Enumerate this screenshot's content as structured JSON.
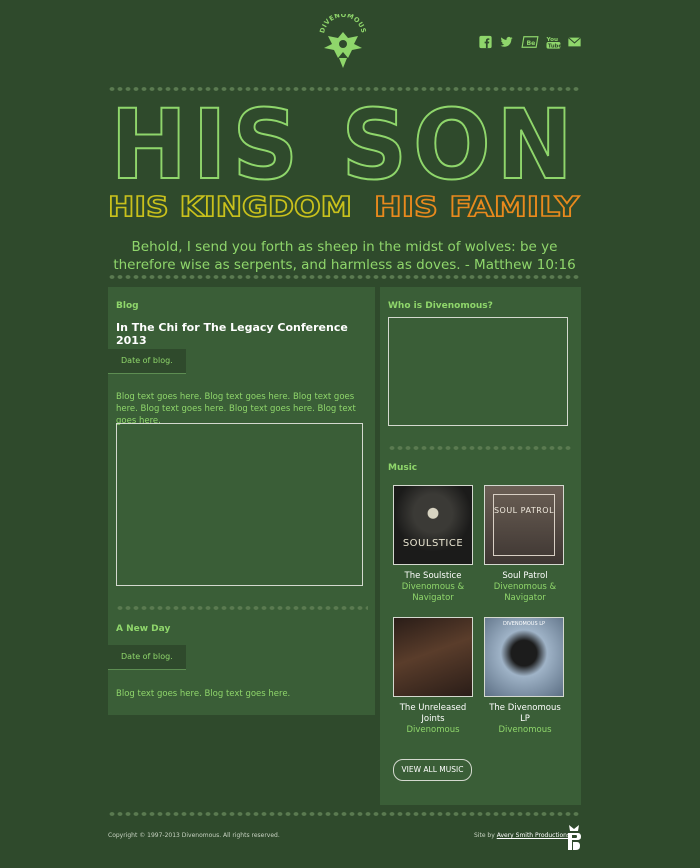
{
  "header": {
    "logo_text": "DIVENOMOUS",
    "social": [
      "facebook-icon",
      "twitter-icon",
      "behance-icon",
      "youtube-icon",
      "email-icon"
    ],
    "hero_title": "HIS SON",
    "subtitle_1": "HIS KINGDOM",
    "subtitle_2": "HIS FAMILY",
    "verse": "Behold, I send you forth as sheep in the midst of wolves: be ye therefore wise as serpents, and harmless as doves. - Matthew 10:16"
  },
  "colors": {
    "background": "#2f4a2c",
    "panel": "#3a5e37",
    "accent_green": "#8fd66b",
    "accent_yellow": "#c9c11c",
    "accent_orange": "#e98a1d"
  },
  "blog": {
    "section_label": "Blog",
    "posts": [
      {
        "title": "In The Chi for The Legacy Conference 2013",
        "date": "Date of blog.",
        "text": "Blog text goes here. Blog text goes here. Blog text goes here. Blog text goes here. Blog text goes here. Blog text goes here."
      },
      {
        "title": "A New Day",
        "date": "Date of blog.",
        "text": "Blog text goes here. Blog text goes here."
      }
    ]
  },
  "about": {
    "section_label": "Who is Divenomous?"
  },
  "music": {
    "section_label": "Music",
    "albums": [
      {
        "title": "The Soulstice",
        "artist": "Divenomous & Navigator",
        "cover_text": "SOULSTICE"
      },
      {
        "title": "Soul Patrol",
        "artist": "Divenomous & Navigator",
        "cover_text": "SOUL PATROL"
      },
      {
        "title": "The Unreleased Joints",
        "artist": "Divenomous",
        "cover_text": ""
      },
      {
        "title": "The Divenomous LP",
        "artist": "Divenomous",
        "cover_text": "DIVENOMOUS LP"
      }
    ],
    "view_all": "VIEW ALL MUSIC"
  },
  "footer": {
    "copyright": "Copyright © 1997-2013 Divenomous. All rights reserved.",
    "site_by_prefix": "Site by",
    "site_by_link": "Avery Smith Productions"
  }
}
